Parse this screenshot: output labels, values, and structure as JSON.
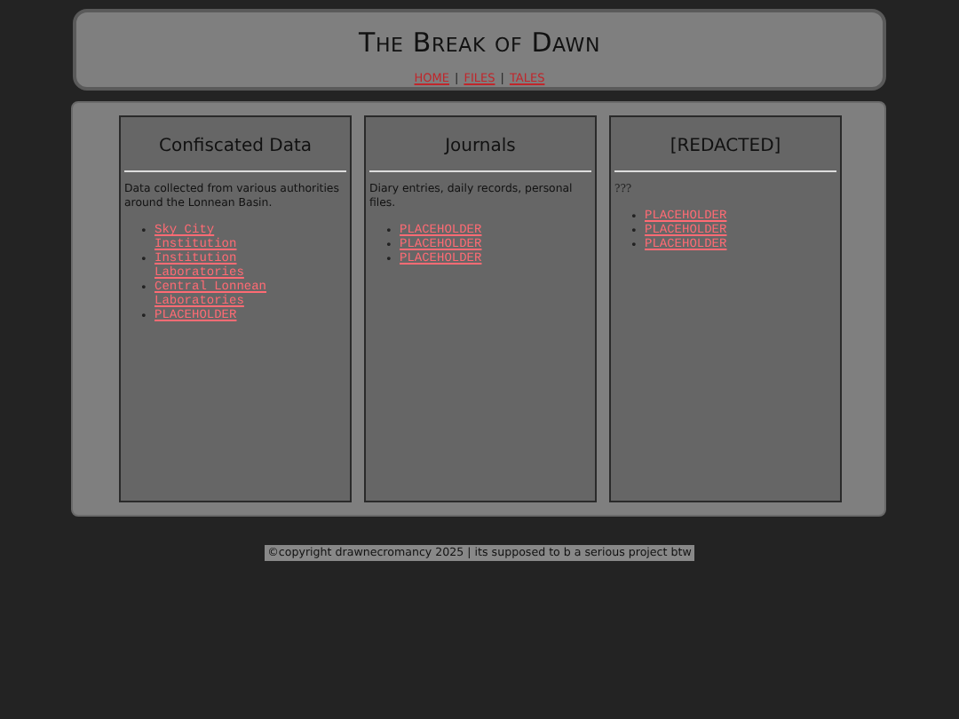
{
  "header": {
    "title": "The Break of Dawn",
    "nav": [
      {
        "label": "HOME"
      },
      {
        "label": "FILES"
      },
      {
        "label": "TALES"
      }
    ],
    "separator": "|"
  },
  "columns": [
    {
      "heading": "Confiscated Data",
      "description": "Data collected from various authorities around the Lonnean Basin.",
      "kind": "sans",
      "links": [
        "Sky City Institution",
        "Institution Laboratories",
        "Central Lonnean Laboratories",
        "PLACEHOLDER"
      ]
    },
    {
      "heading": "Journals",
      "description": "Diary entries, daily records, personal files.",
      "kind": "sans",
      "links": [
        "PLACEHOLDER",
        "PLACEHOLDER",
        "PLACEHOLDER"
      ]
    },
    {
      "heading": "[REDACTED]",
      "description": "???",
      "kind": "serif",
      "links": [
        "PLACEHOLDER",
        "PLACEHOLDER",
        "PLACEHOLDER"
      ]
    }
  ],
  "bullet": "•",
  "footer": "©copyright drawnecromancy 2025 | its supposed to b a serious project btw"
}
